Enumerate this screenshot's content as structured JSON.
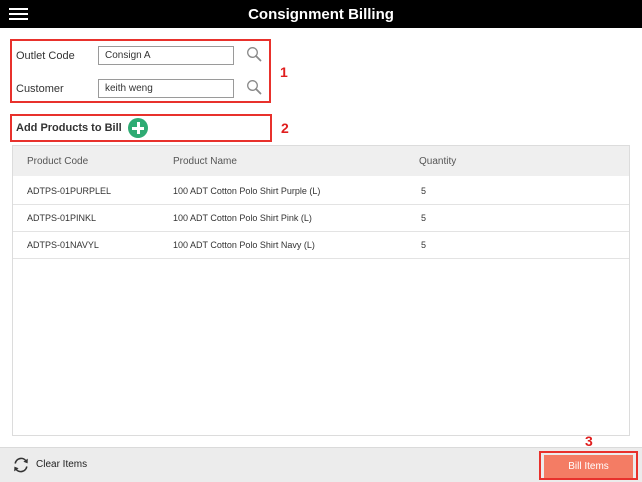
{
  "header": {
    "title": "Consignment Billing",
    "menu_icon": "hamburger-menu-icon"
  },
  "form": {
    "outlet_code": {
      "label": "Outlet Code",
      "value": "Consign A",
      "icon": "search-icon"
    },
    "customer": {
      "label": "Customer",
      "value": "keith weng",
      "icon": "search-icon"
    }
  },
  "add_products": {
    "label": "Add Products to Bill",
    "icon": "add-circle-icon"
  },
  "table": {
    "columns": [
      "Product Code",
      "Product Name",
      "Quantity"
    ],
    "rows": [
      {
        "code": "ADTPS-01PURPLEL",
        "name": "100 ADT Cotton Polo Shirt Purple (L)",
        "qty": "5"
      },
      {
        "code": "ADTPS-01PINKL",
        "name": "100 ADT Cotton Polo Shirt Pink (L)",
        "qty": "5"
      },
      {
        "code": "ADTPS-01NAVYL",
        "name": "100 ADT Cotton Polo Shirt Navy (L)",
        "qty": "5"
      }
    ]
  },
  "footer": {
    "clear_label": "Clear Items",
    "clear_icon": "refresh-icon",
    "bill_label": "Bill Items"
  },
  "annotations": [
    "1",
    "2",
    "3"
  ],
  "colors": {
    "header_bg": "#000000",
    "annotation_red": "#e8312c",
    "add_green": "#2eab73",
    "bill_button": "#f47c64"
  }
}
